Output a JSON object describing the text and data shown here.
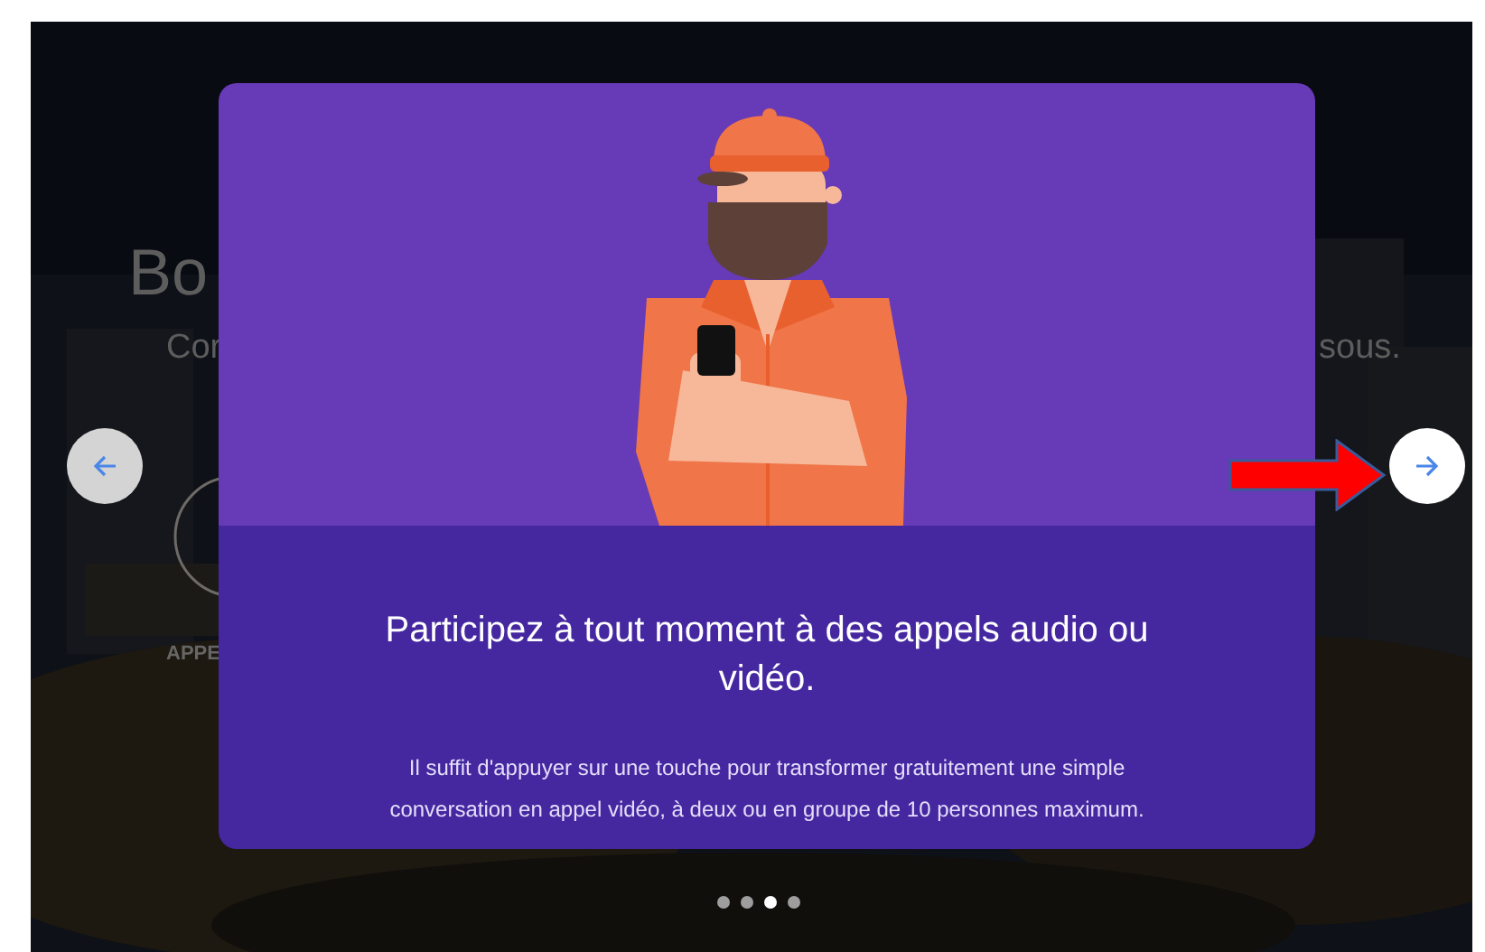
{
  "background": {
    "texts": [
      {
        "kind": "heading",
        "text": "Bo"
      },
      {
        "kind": "subtitle",
        "text": "Cor"
      },
      {
        "kind": "subtitle-end",
        "text": "sous."
      },
      {
        "kind": "label",
        "text": "APPE"
      }
    ]
  },
  "dialog": {
    "title": "Participez à tout moment à des appels audio ou vidéo.",
    "body": "Il suffit d'appuyer sur une touche pour transformer gratuitement une simple conversation en appel vidéo, à deux ou en groupe de 10 personnes maximum."
  },
  "nav": {
    "previous": {
      "disabled": true
    },
    "next": {
      "disabled": false
    }
  },
  "dots": [
    {
      "selected": false
    },
    {
      "selected": false
    },
    {
      "selected": true
    },
    {
      "selected": false
    }
  ]
}
